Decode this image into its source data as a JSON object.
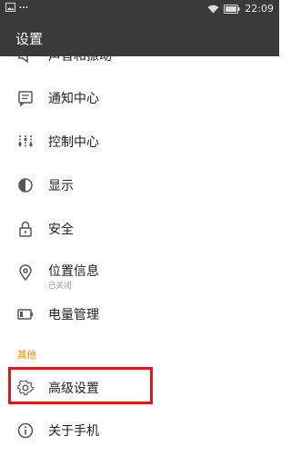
{
  "status_bar": {
    "left_icons": [
      "image-icon",
      "more-dots-icon"
    ],
    "time": "22:09",
    "right_icons": [
      "wifi-icon",
      "battery-icon"
    ]
  },
  "app_bar": {
    "title": "设置"
  },
  "list": {
    "partial_item": {
      "label": "声音和振动",
      "icon": "speaker-icon"
    },
    "items": [
      {
        "label": "通知中心",
        "icon": "notification-icon"
      },
      {
        "label": "控制中心",
        "icon": "sliders-icon"
      },
      {
        "label": "显示",
        "icon": "contrast-icon"
      },
      {
        "label": "安全",
        "icon": "lock-icon"
      },
      {
        "label": "位置信息",
        "sublabel": "已关闭",
        "icon": "location-pin-icon"
      },
      {
        "label": "电量管理",
        "icon": "battery-icon"
      }
    ],
    "section_other": {
      "header": "其他",
      "items": [
        {
          "label": "高级设置",
          "icon": "gear-icon"
        },
        {
          "label": "关于手机",
          "icon": "info-icon"
        }
      ]
    }
  },
  "colors": {
    "bar_background": "#3a3a3a",
    "section_header": "#f08a00",
    "highlight_border": "#d9191c",
    "icon_color": "#555555"
  }
}
